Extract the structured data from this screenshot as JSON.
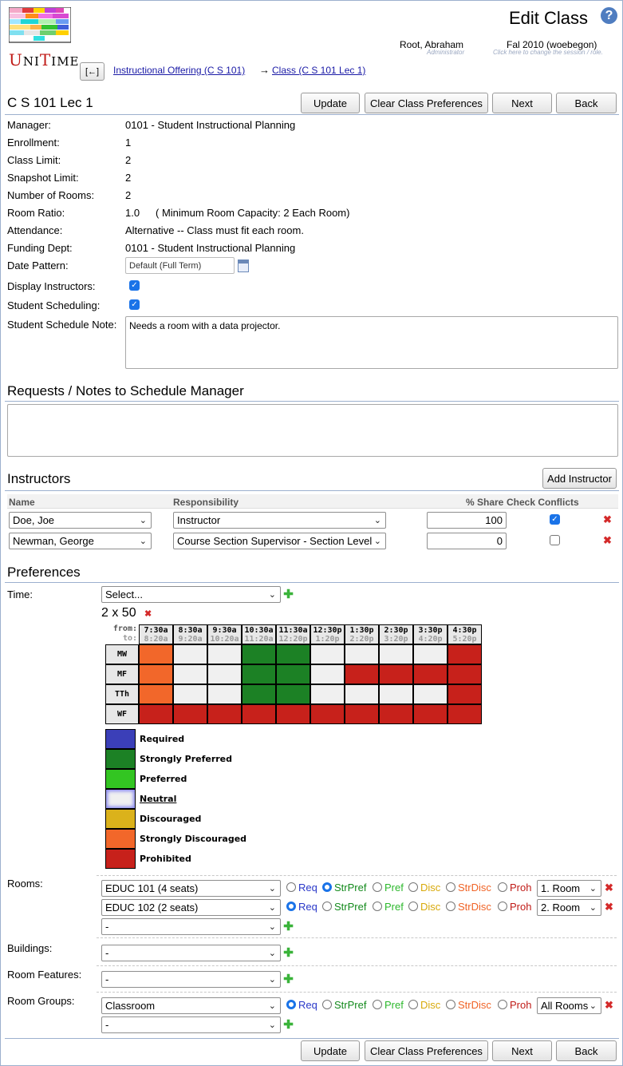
{
  "app": {
    "logo_text": "UniTime",
    "page_title": "Edit Class",
    "help_icon": "help-icon"
  },
  "user": {
    "name": "Root, Abraham",
    "role": "Administrator"
  },
  "session": {
    "name": "Fal 2010 (woebegon)",
    "hint": "Click here to change the session / role."
  },
  "nav": {
    "back_label": "[←]",
    "crumb1": "Instructional Offering (C S 101)",
    "arrow": "→",
    "crumb2": "Class (C S 101 Lec 1)"
  },
  "class_title": "C S 101 Lec 1",
  "buttons": {
    "update": "Update",
    "clear": "Clear Class Preferences",
    "next": "Next",
    "back": "Back",
    "add_instructor": "Add Instructor"
  },
  "fields": {
    "manager": {
      "label": "Manager:",
      "value": "0101 - Student Instructional Planning"
    },
    "enrollment": {
      "label": "Enrollment:",
      "value": "1"
    },
    "class_limit": {
      "label": "Class Limit:",
      "value": "2"
    },
    "snapshot_limit": {
      "label": "Snapshot Limit:",
      "value": "2"
    },
    "num_rooms": {
      "label": "Number of Rooms:",
      "value": "2"
    },
    "room_ratio": {
      "label": "Room Ratio:",
      "value": "1.0",
      "note": "( Minimum Room Capacity: 2 Each Room)"
    },
    "attendance": {
      "label": "Attendance:",
      "value": "Alternative -- Class must fit each room."
    },
    "funding": {
      "label": "Funding Dept:",
      "value": "0101 - Student Instructional Planning"
    },
    "date_pattern": {
      "label": "Date Pattern:",
      "value": "Default (Full Term)"
    },
    "display_instructors": {
      "label": "Display Instructors:",
      "checked": true
    },
    "student_scheduling": {
      "label": "Student Scheduling:",
      "checked": true
    },
    "schedule_note": {
      "label": "Student Schedule Note:",
      "value": "Needs a room with a data projector."
    }
  },
  "requests": {
    "heading": "Requests / Notes to Schedule Manager",
    "value": ""
  },
  "instructors": {
    "heading": "Instructors",
    "col_name": "Name",
    "col_resp": "Responsibility",
    "col_share": "% Share",
    "col_check": "Check Conflicts",
    "rows": [
      {
        "name": "Doe, Joe",
        "resp": "Instructor",
        "share": "100",
        "check": true
      },
      {
        "name": "Newman, George",
        "resp": "Course Section Supervisor - Section Level",
        "share": "0",
        "check": false
      }
    ]
  },
  "preferences": {
    "heading": "Preferences",
    "time_label": "Time:",
    "time_select": "Select...",
    "pattern": "2 x 50",
    "from_label": "from:",
    "to_label": "to:",
    "times": [
      {
        "f": "7:30a",
        "t": "8:20a"
      },
      {
        "f": "8:30a",
        "t": "9:20a"
      },
      {
        "f": "9:30a",
        "t": "10:20a"
      },
      {
        "f": "10:30a",
        "t": "11:20a"
      },
      {
        "f": "11:30a",
        "t": "12:20p"
      },
      {
        "f": "12:30p",
        "t": "1:20p"
      },
      {
        "f": "1:30p",
        "t": "2:20p"
      },
      {
        "f": "2:30p",
        "t": "3:20p"
      },
      {
        "f": "3:30p",
        "t": "4:20p"
      },
      {
        "f": "4:30p",
        "t": "5:20p"
      }
    ],
    "days": [
      "MW",
      "MF",
      "TTh",
      "WF"
    ],
    "grid": [
      [
        "S",
        "N",
        "N",
        "SP",
        "SP",
        "N",
        "N",
        "N",
        "N",
        "P"
      ],
      [
        "S",
        "N",
        "N",
        "SP",
        "SP",
        "N",
        "P",
        "P",
        "P",
        "P"
      ],
      [
        "S",
        "N",
        "N",
        "SP",
        "SP",
        "N",
        "N",
        "N",
        "N",
        "P"
      ],
      [
        "P",
        "P",
        "P",
        "P",
        "P",
        "P",
        "P",
        "P",
        "P",
        "P"
      ]
    ],
    "colors": {
      "R": "#3b3fb8",
      "SP": "#1c8125",
      "PR": "#33c522",
      "N": "#f0f0f0",
      "D": "#dbb21b",
      "S": "#f2672a",
      "P": "#c7211b"
    },
    "legend": [
      {
        "k": "R",
        "label": "Required"
      },
      {
        "k": "SP",
        "label": "Strongly Preferred"
      },
      {
        "k": "PR",
        "label": "Preferred"
      },
      {
        "k": "N",
        "label": "Neutral"
      },
      {
        "k": "D",
        "label": "Discouraged"
      },
      {
        "k": "S",
        "label": "Strongly Discouraged"
      },
      {
        "k": "P",
        "label": "Prohibited"
      }
    ]
  },
  "levels": {
    "req": "Req",
    "strpref": "StrPref",
    "pref": "Pref",
    "disc": "Disc",
    "strdisc": "StrDisc",
    "proh": "Proh"
  },
  "level_colors": {
    "req": "#2a38c9",
    "strpref": "#138a1c",
    "pref": "#2db82d",
    "disc": "#d8a90a",
    "strdisc": "#f06427",
    "proh": "#c01b17"
  },
  "rooms": {
    "label": "Rooms:",
    "rows": [
      {
        "room": "EDUC 101 (4 seats)",
        "level": "strpref",
        "index": "1. Room"
      },
      {
        "room": "EDUC 102 (2 seats)",
        "level": "req",
        "index": "2. Room"
      }
    ],
    "empty": "-"
  },
  "buildings": {
    "label": "Buildings:",
    "value": "-"
  },
  "room_features": {
    "label": "Room Features:",
    "value": "-"
  },
  "room_groups": {
    "label": "Room Groups:",
    "rows": [
      {
        "value": "Classroom",
        "level": "req",
        "index": "All Rooms"
      }
    ],
    "empty": "-"
  }
}
